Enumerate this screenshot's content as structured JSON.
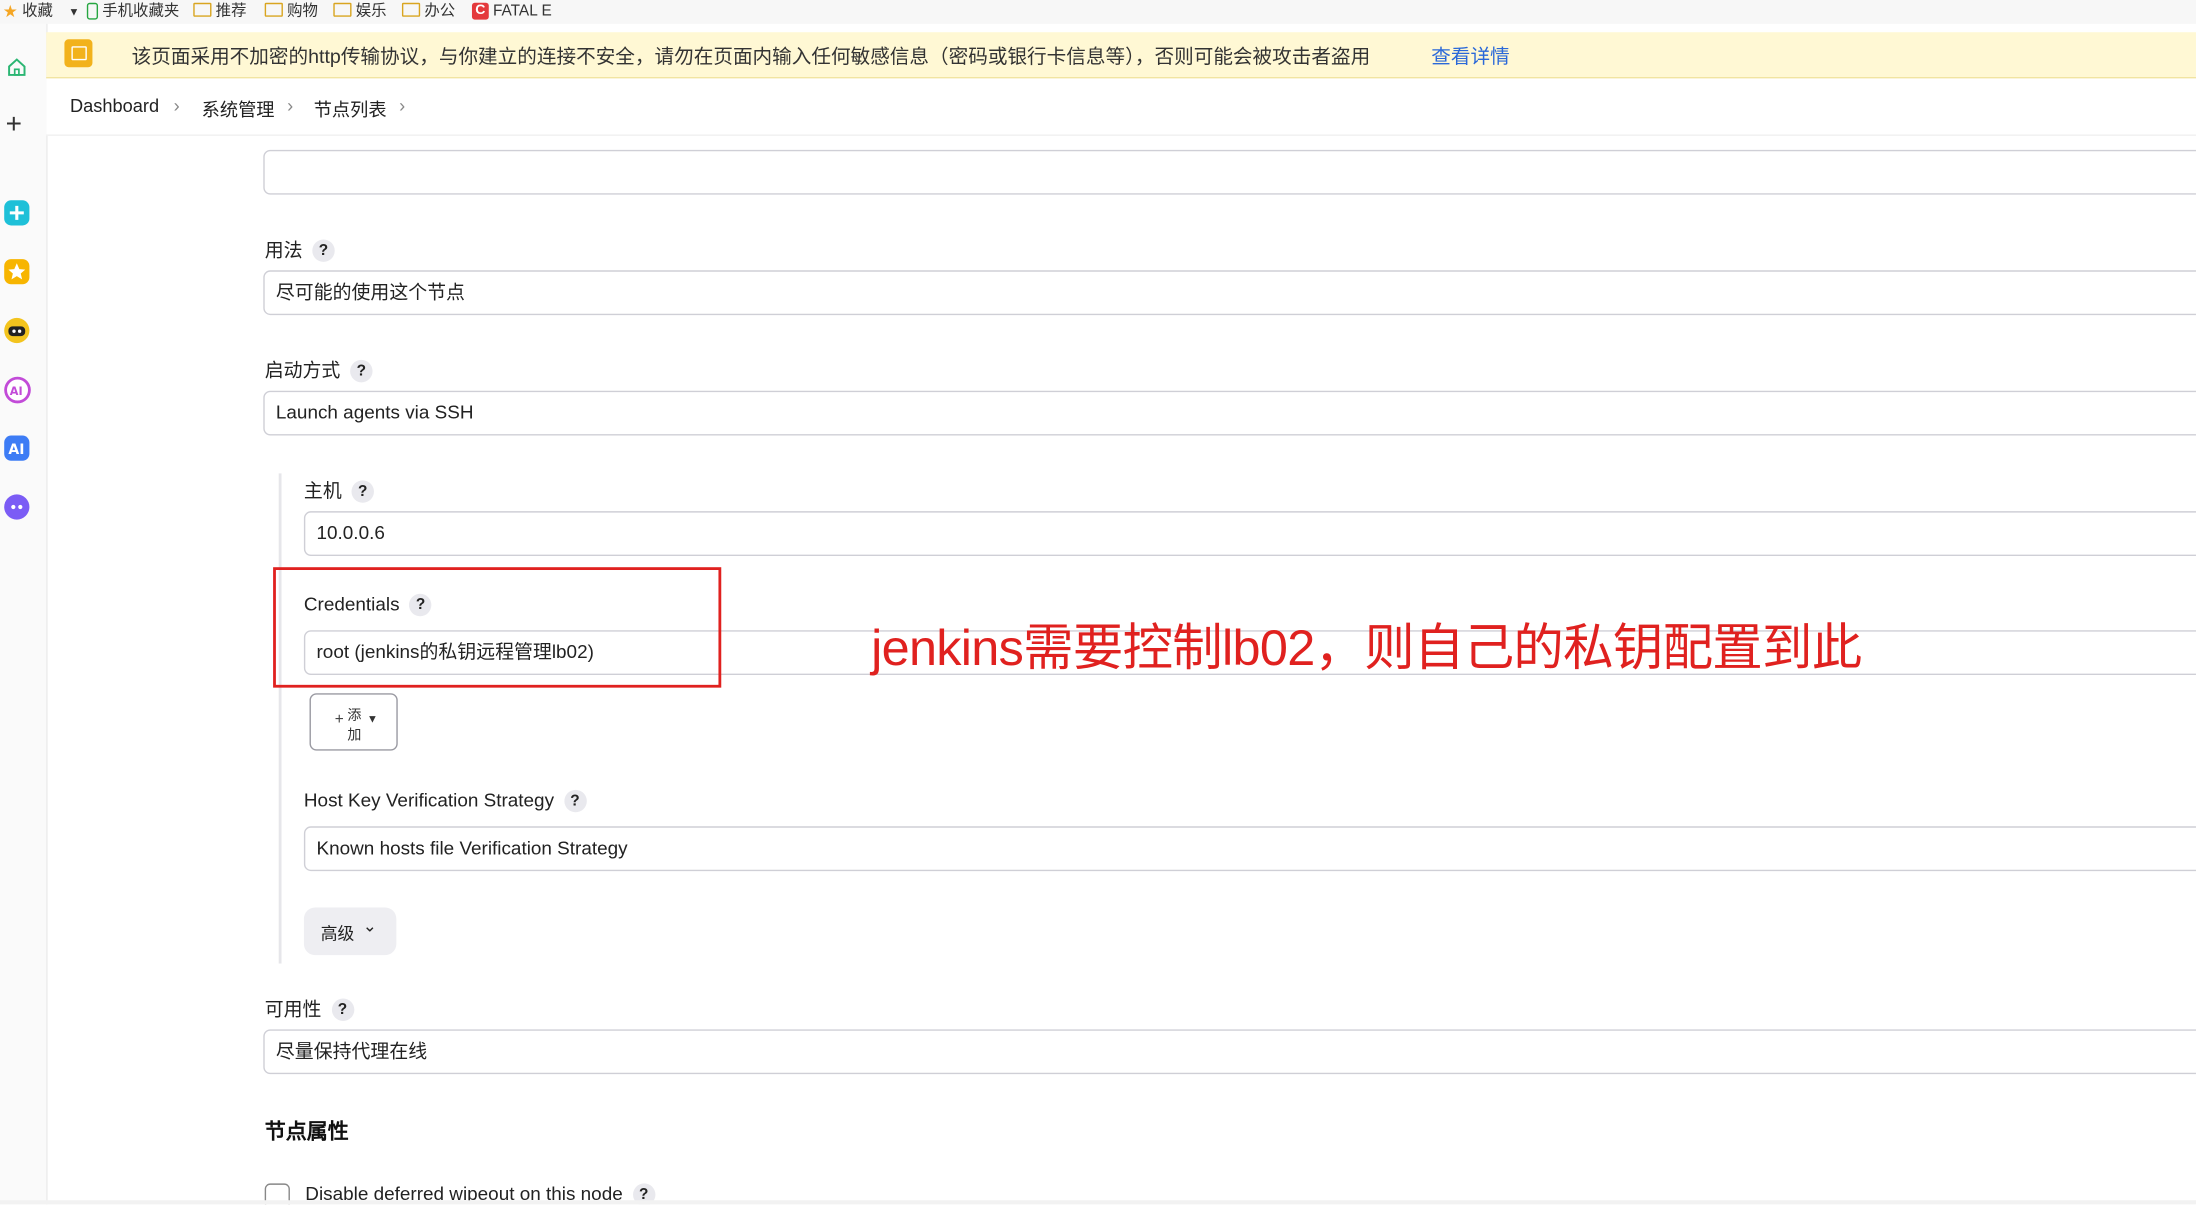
{
  "bookmarks": [
    {
      "label": "收藏",
      "icon": "star-icon"
    },
    {
      "label": "手机收藏夹",
      "icon": "phone-icon"
    },
    {
      "label": "推荐",
      "icon": "folder-icon"
    },
    {
      "label": "购物",
      "icon": "folder-icon"
    },
    {
      "label": "娱乐",
      "icon": "folder-icon"
    },
    {
      "label": "办公",
      "icon": "folder-icon"
    },
    {
      "label": "FATAL E",
      "icon": "csdn-icon"
    }
  ],
  "sidebar": {
    "items": [
      "home-icon",
      "add-icon",
      "app-icon",
      "favorites-icon",
      "robot-icon",
      "ai-assistant-icon",
      "ai-icon",
      "chat-icon"
    ]
  },
  "banner": {
    "text": "该页面采用不加密的http传输协议，与你建立的连接不安全，请勿在页面内输入任何敏感信息（密码或银行卡信息等），否则可能会被攻击者盗用",
    "link": "查看详情",
    "link_color": "#2a68d8"
  },
  "breadcrumb": [
    "Dashboard",
    "系统管理",
    "节点列表"
  ],
  "form": {
    "top_field_value": "",
    "usage": {
      "label": "用法",
      "value": "尽可能的使用这个节点"
    },
    "launch": {
      "label": "启动方式",
      "value": "Launch agents via SSH"
    },
    "host": {
      "label": "主机",
      "value": "10.0.0.6"
    },
    "credentials": {
      "label": "Credentials",
      "value": "root (jenkins的私钥远程管理lb02)"
    },
    "add_button": {
      "line1": "添",
      "line2": "加",
      "plus": "+"
    },
    "host_key": {
      "label": "Host Key Verification Strategy",
      "value": "Known hosts file Verification Strategy"
    },
    "advanced": {
      "label": "高级"
    },
    "availability": {
      "label": "可用性",
      "value": "尽量保持代理在线"
    },
    "node_props": {
      "title": "节点属性"
    },
    "wipeout": {
      "label": "Disable deferred wipeout on this node"
    },
    "help_glyph": "?"
  },
  "annotation": {
    "text": "jenkins需要控制lb02，则自己的私钥配置到此",
    "color": "#e0211f"
  }
}
